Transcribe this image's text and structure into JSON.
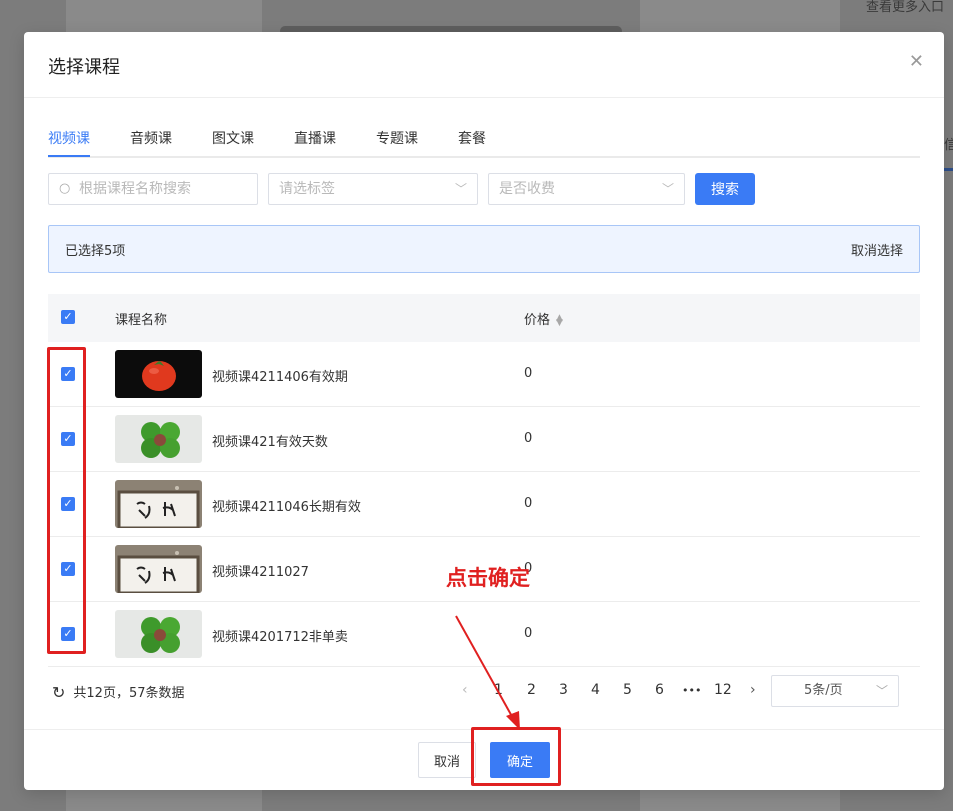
{
  "background": {
    "top_right_text": "查看更多入口",
    "side_char": "信"
  },
  "modal": {
    "title": "选择课程",
    "close_icon": "close-icon"
  },
  "tabs": [
    {
      "label": "视频课",
      "active": true
    },
    {
      "label": "音频课",
      "active": false
    },
    {
      "label": "图文课",
      "active": false
    },
    {
      "label": "直播课",
      "active": false
    },
    {
      "label": "专题课",
      "active": false
    },
    {
      "label": "套餐",
      "active": false
    }
  ],
  "filters": {
    "search_placeholder": "根据课程名称搜索",
    "tag_placeholder": "请选标签",
    "fee_placeholder": "是否收费",
    "search_button": "搜索"
  },
  "selection": {
    "summary": "已选择5项",
    "clear": "取消选择"
  },
  "table": {
    "columns": [
      "课程名称",
      "价格"
    ],
    "rows": [
      {
        "name": "视频课4211406有效期",
        "price": "0",
        "thumb": "tomato",
        "checked": true
      },
      {
        "name": "视频课421有效天数",
        "price": "0",
        "thumb": "clover",
        "checked": true
      },
      {
        "name": "视频课4211046长期有效",
        "price": "0",
        "thumb": "frame",
        "checked": true
      },
      {
        "name": "视频课4211027",
        "price": "0",
        "thumb": "frame",
        "checked": true
      },
      {
        "name": "视频课4201712非单卖",
        "price": "0",
        "thumb": "clover",
        "checked": true
      }
    ]
  },
  "pagination": {
    "summary": "共12页，57条数据",
    "pages": [
      "1",
      "2",
      "3",
      "4",
      "5",
      "6",
      "•••",
      "12"
    ],
    "current": "1",
    "page_size": "5条/页"
  },
  "footer": {
    "cancel": "取消",
    "confirm": "确定"
  },
  "annotation": {
    "text": "点击确定",
    "color": "#e02020"
  },
  "colors": {
    "primary": "#3a7bf5",
    "annotation": "#e02020"
  }
}
